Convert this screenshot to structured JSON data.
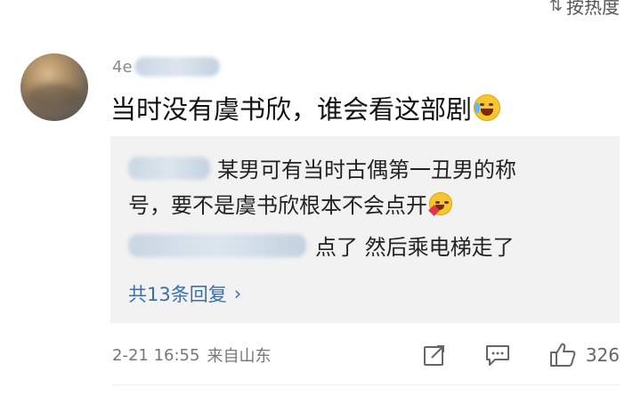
{
  "sort": {
    "label": "按热度"
  },
  "comment": {
    "username_prefix": "4e",
    "text": "当时没有虞书欣，谁会看这部剧",
    "emoji": "crying-laughing-emoji",
    "time": "2-21 16:55",
    "location": "来自山东",
    "like_count": "326"
  },
  "replies": [
    {
      "text_line1": "某男可有当时古偶第一丑男的称",
      "text_line2": "号，要不是虞书欣根本不会点开",
      "emoji": "kiss-emoji"
    },
    {
      "text": "点了  然后乘电梯走了"
    }
  ],
  "more_replies": {
    "label": "共13条回复"
  },
  "colors": {
    "link": "#3b6fa8",
    "reply_bg": "#f2f2f2",
    "meta": "#777777"
  }
}
